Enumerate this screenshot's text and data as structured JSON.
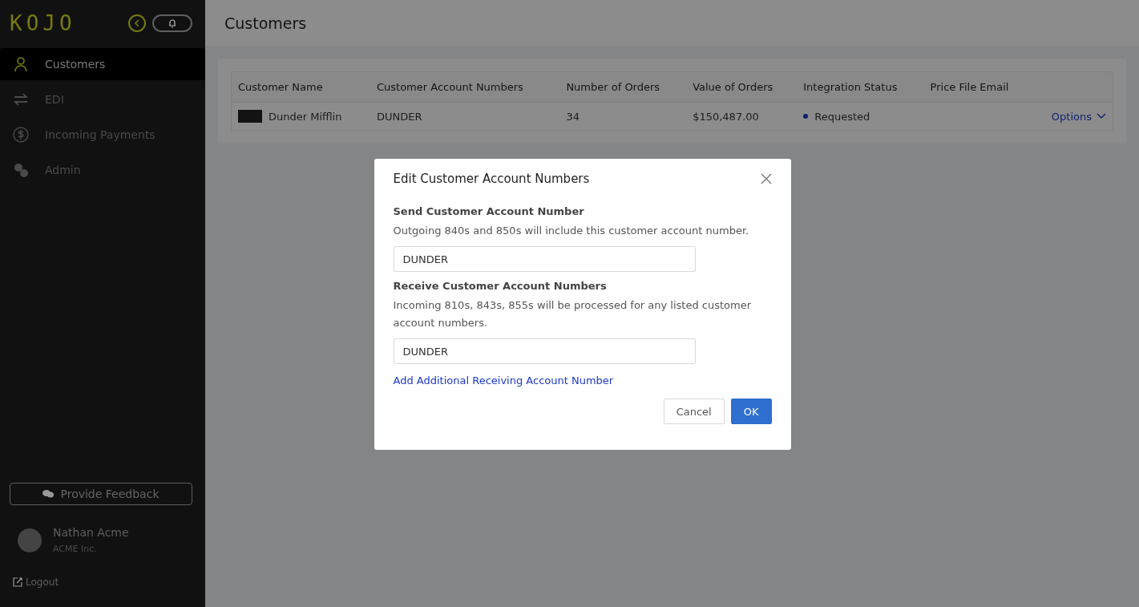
{
  "sidebar": {
    "logo": "KOJO",
    "items": [
      {
        "label": "Customers",
        "selected": true
      },
      {
        "label": "EDI",
        "selected": false
      },
      {
        "label": "Incoming Payments",
        "selected": false
      },
      {
        "label": "Admin",
        "selected": false
      }
    ],
    "feedback_button": "Provide Feedback",
    "user": {
      "name": "Nathan Acme",
      "company": "ACME Inc."
    },
    "logout": "Logout"
  },
  "page_title": "Customers",
  "table": {
    "columns": [
      "Customer Name",
      "Customer Account Numbers",
      "Number of Orders",
      "Value of Orders",
      "Integration Status",
      "Price File Email"
    ],
    "rows": [
      {
        "name": "Dunder Mifflin",
        "accounts": "DUNDER",
        "orders": "34",
        "value": "$150,487.00",
        "status": "Requested",
        "color": "#101f6c",
        "action": "Options"
      }
    ]
  },
  "dialog": {
    "title": "Edit Customer Account Numbers",
    "send_heading": "Send Customer Account Number",
    "send_help": "Outgoing 840s and 850s will include this customer account number.",
    "send_value": "DUNDER",
    "receive_heading": "Receive Customer Account Numbers",
    "receive_help": "Incoming 810s, 843s, 855s will be processed for any listed customer account numbers.",
    "receive_values": [
      "DUNDER"
    ],
    "add_link": "Add Additional Receiving Account Number",
    "buttons": [
      {
        "kind": "default",
        "label": "Cancel"
      },
      {
        "kind": "primary",
        "label": "OK"
      }
    ]
  }
}
